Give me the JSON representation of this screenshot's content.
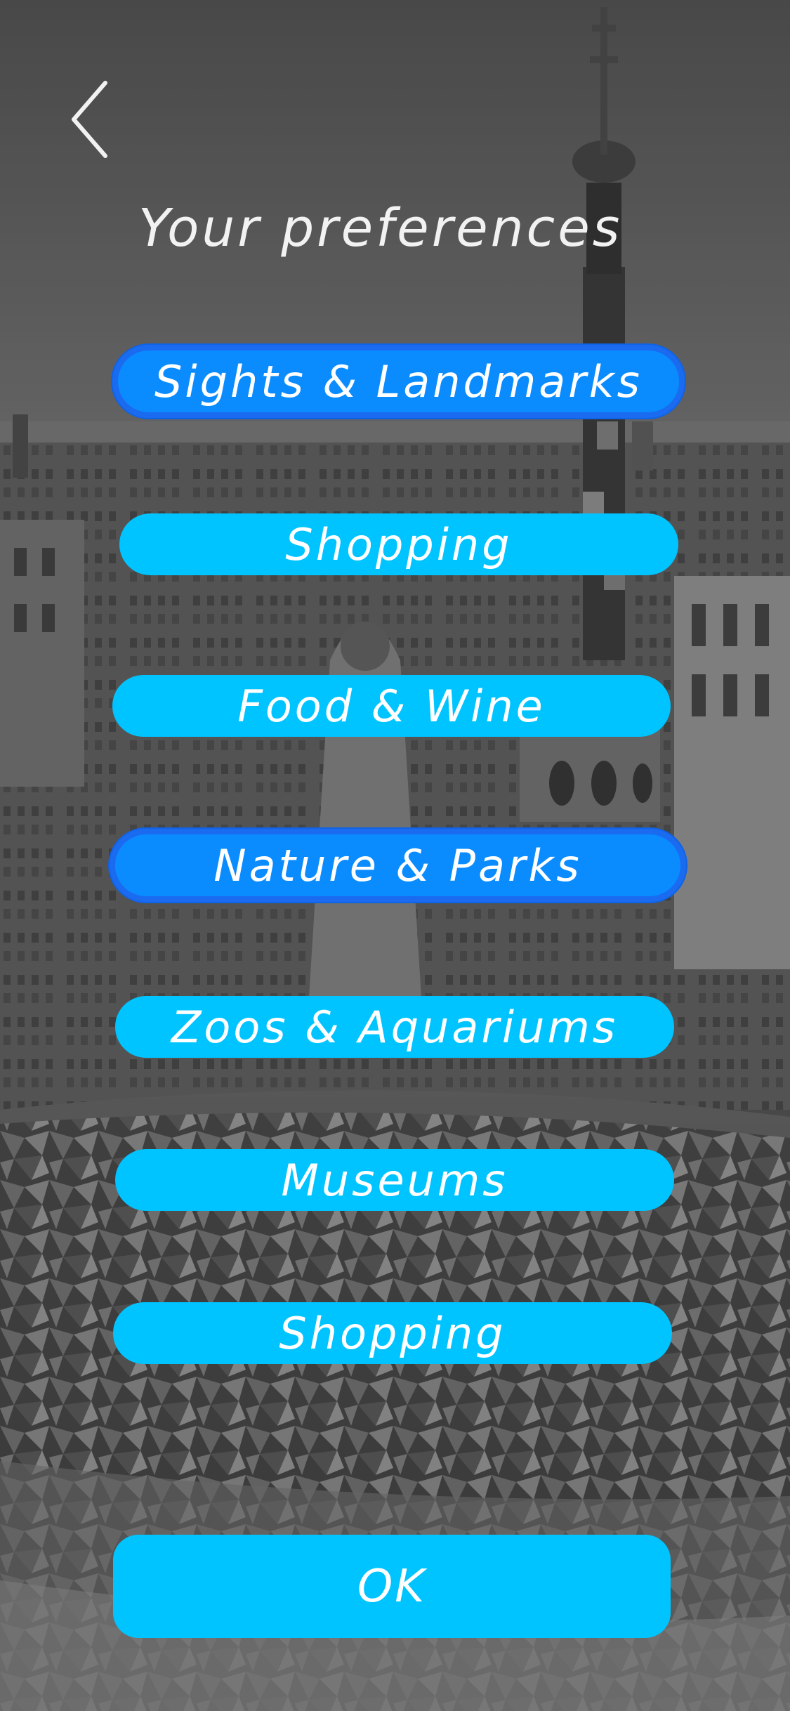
{
  "header": {
    "back_icon": "chevron-left-icon",
    "title": "Your preferences"
  },
  "preferences": [
    {
      "label": "Sights & Landmarks",
      "selected": true
    },
    {
      "label": "Shopping",
      "selected": false
    },
    {
      "label": "Food & Wine",
      "selected": false
    },
    {
      "label": "Nature & Parks",
      "selected": true
    },
    {
      "label": "Zoos & Aquariums",
      "selected": false
    },
    {
      "label": "Museums",
      "selected": false
    },
    {
      "label": "Shopping",
      "selected": false
    }
  ],
  "ok_button": {
    "label": "OK"
  },
  "colors": {
    "button": "#00c4ff",
    "button_selected": "#0a8cff",
    "button_selected_border": "#1a6bf0",
    "text": "#ffffff"
  }
}
